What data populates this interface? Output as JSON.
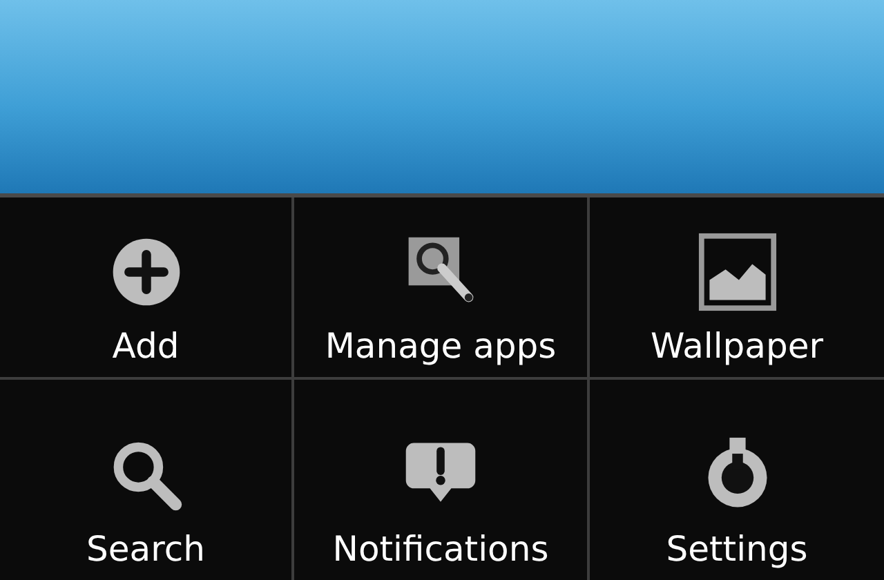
{
  "menu": {
    "items": [
      {
        "label": "Add",
        "kind": "add"
      },
      {
        "label": "Manage apps",
        "kind": "manage"
      },
      {
        "label": "Wallpaper",
        "kind": "wallpaper"
      },
      {
        "label": "Search",
        "kind": "search"
      },
      {
        "label": "Notifications",
        "kind": "notifications"
      },
      {
        "label": "Settings",
        "kind": "settings"
      }
    ]
  }
}
